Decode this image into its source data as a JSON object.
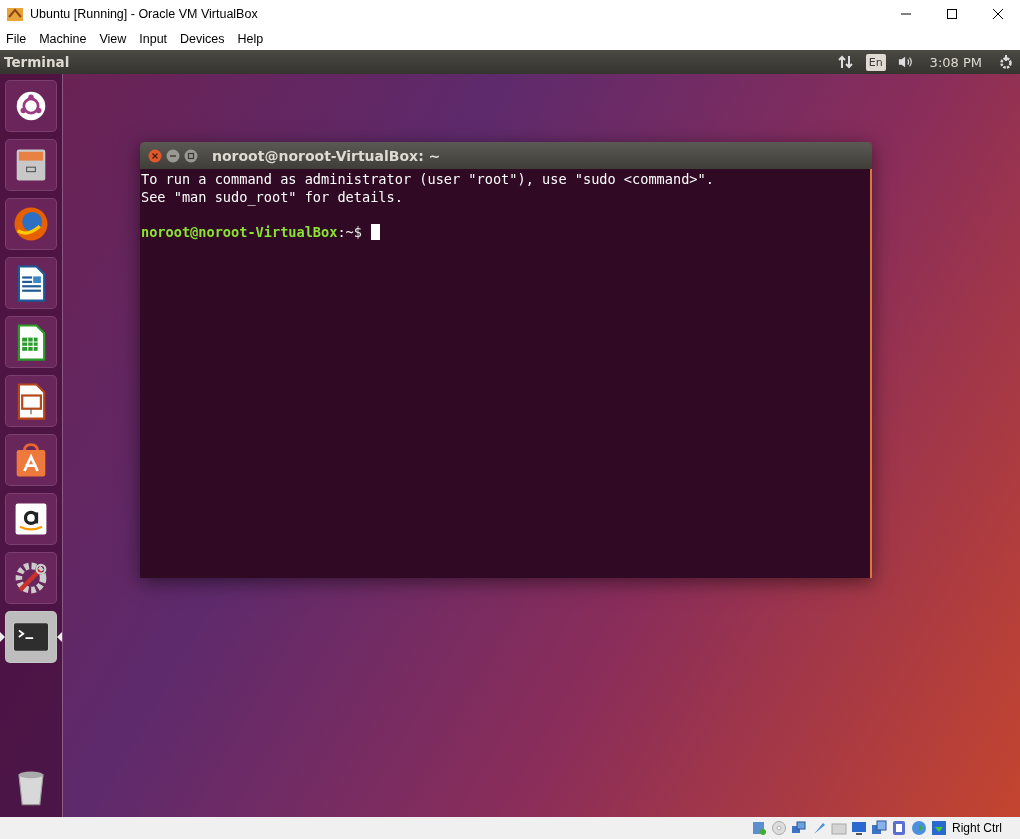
{
  "window": {
    "title": "Ubuntu [Running] - Oracle VM VirtualBox"
  },
  "menu": [
    "File",
    "Machine",
    "View",
    "Input",
    "Devices",
    "Help"
  ],
  "top_panel": {
    "app_title": "Terminal",
    "keyboard": "En",
    "clock": "3:08 PM"
  },
  "launcher": [
    {
      "kind": "dash",
      "selected": false
    },
    {
      "kind": "files",
      "selected": false
    },
    {
      "kind": "browser",
      "selected": false
    },
    {
      "kind": "writer",
      "selected": false
    },
    {
      "kind": "calc",
      "selected": false
    },
    {
      "kind": "impress",
      "selected": false
    },
    {
      "kind": "store",
      "selected": false
    },
    {
      "kind": "shop",
      "selected": false
    },
    {
      "kind": "settings",
      "selected": false
    },
    {
      "kind": "terminal",
      "selected": true
    },
    {
      "kind": "trash",
      "selected": false
    }
  ],
  "terminal": {
    "title": "noroot@noroot-VirtualBox: ~",
    "output": [
      "To run a command as administrator (user \"root\"), use \"sudo <command>\".",
      "See \"man sudo_root\" for details."
    ],
    "prompt": {
      "user_host": "noroot@noroot-VirtualBox",
      "path": ":~$"
    }
  },
  "status_bar": {
    "host_key": "Right Ctrl"
  }
}
